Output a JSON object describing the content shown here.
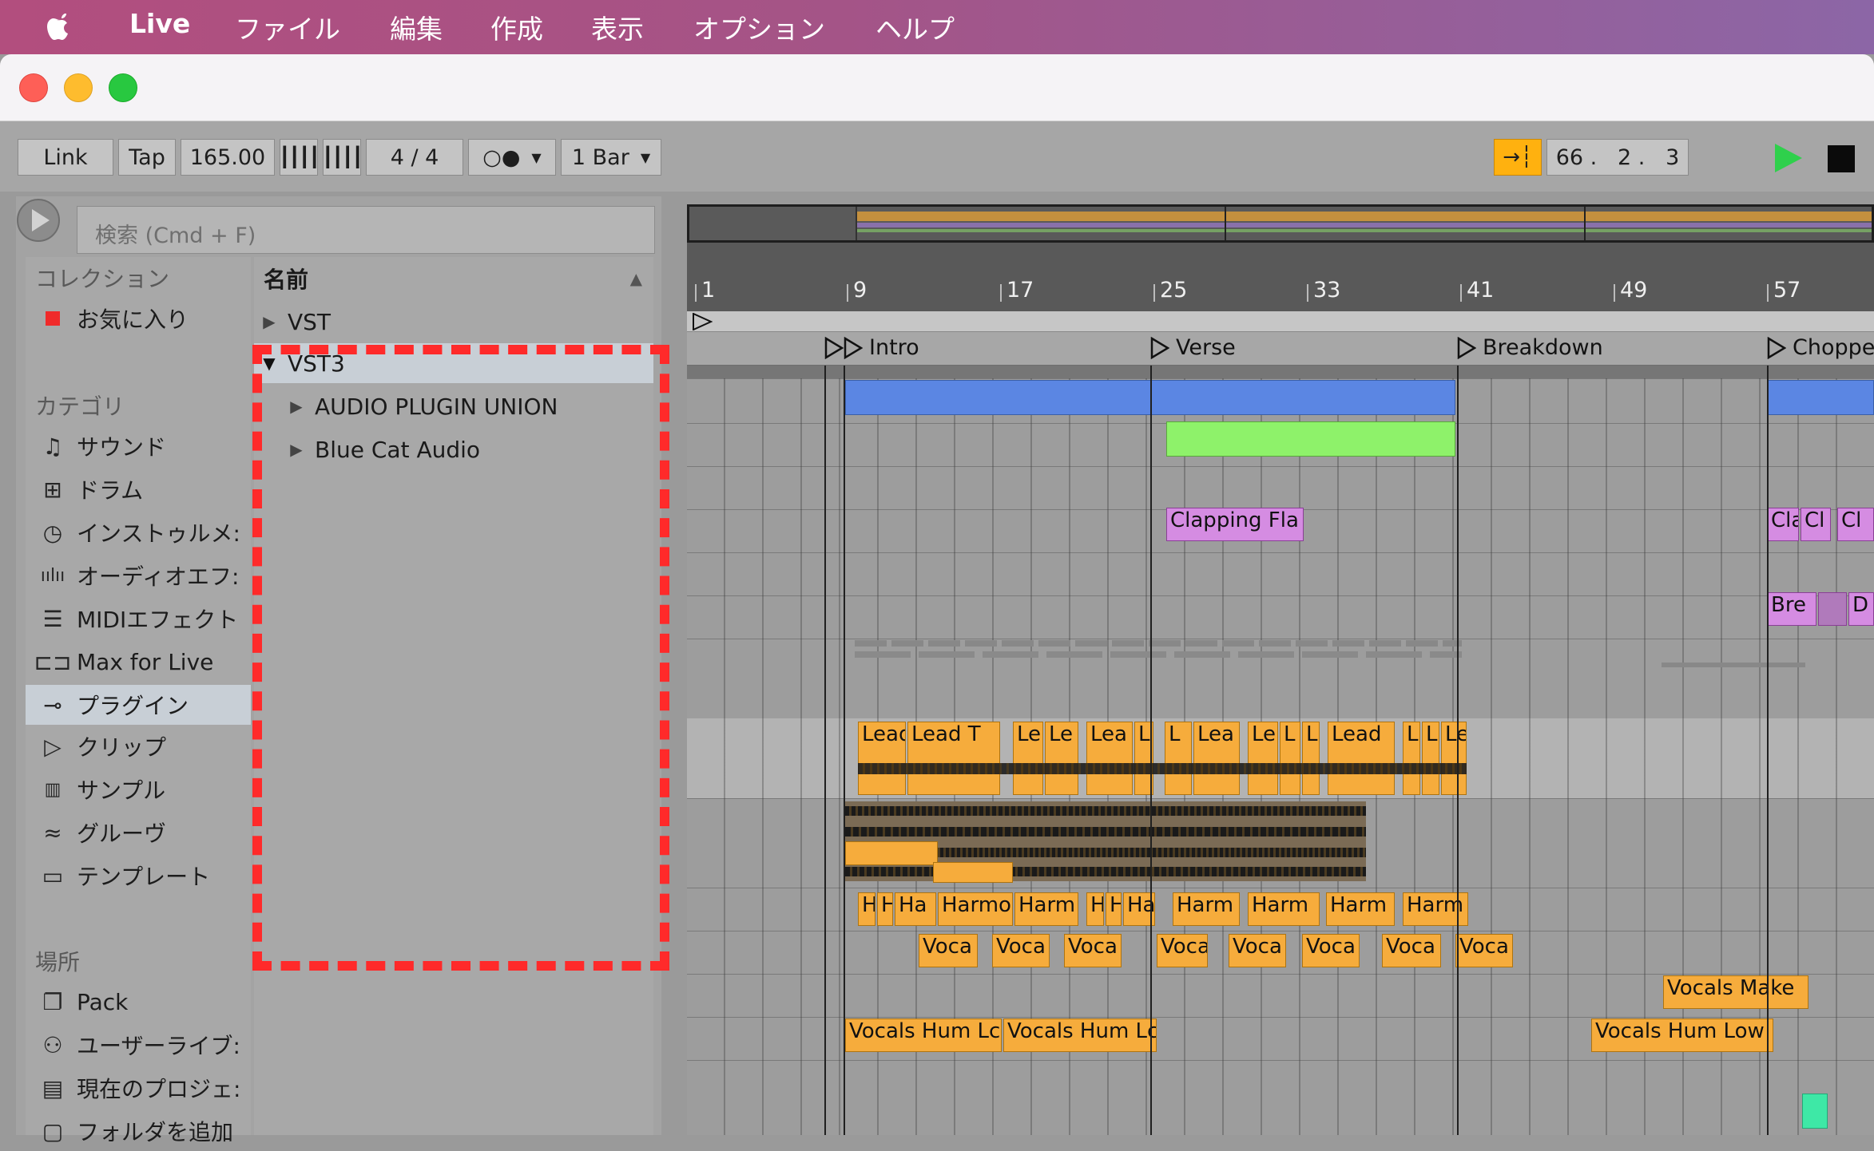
{
  "menubar": {
    "app_name": "Live",
    "items": [
      "ファイル",
      "編集",
      "作成",
      "表示",
      "オプション",
      "ヘルプ"
    ]
  },
  "transport": {
    "link": "Link",
    "tap": "Tap",
    "tempo": "165.00",
    "signature": "4 / 4",
    "metronome": "○●",
    "quantize": "1 Bar",
    "position": "66 .   2 .   3"
  },
  "browser": {
    "search_placeholder": "検索 (Cmd + F)",
    "collections_header": "コレクション",
    "favorites": "お気に入り",
    "categories_header": "カテゴリ",
    "categories": [
      {
        "label": "サウンド",
        "icon": "note-icon"
      },
      {
        "label": "ドラム",
        "icon": "grid-icon"
      },
      {
        "label": "インストゥルメ:",
        "icon": "clock-icon"
      },
      {
        "label": "オーディオエフ:",
        "icon": "waveform-icon"
      },
      {
        "label": "MIDIエフェクト",
        "icon": "midi-icon"
      },
      {
        "label": "Max for Live",
        "icon": "max-icon"
      },
      {
        "label": "プラグイン",
        "icon": "plug-icon"
      },
      {
        "label": "クリップ",
        "icon": "clip-icon"
      },
      {
        "label": "サンプル",
        "icon": "sample-icon"
      },
      {
        "label": "グルーヴ",
        "icon": "groove-icon"
      },
      {
        "label": "テンプレート",
        "icon": "template-icon"
      }
    ],
    "places_header": "場所",
    "places": [
      {
        "label": "Pack",
        "icon": "pack-icon"
      },
      {
        "label": "ユーザーライブ:",
        "icon": "user-icon"
      },
      {
        "label": "現在のプロジェ:",
        "icon": "project-icon"
      },
      {
        "label": "フォルダを追加",
        "icon": "folder-icon"
      }
    ],
    "list_header": "名前",
    "list_items": [
      {
        "label": "VST",
        "expanded": false,
        "indent": 0
      },
      {
        "label": "VST3",
        "expanded": true,
        "indent": 0
      },
      {
        "label": "AUDIO PLUGIN UNION",
        "expanded": false,
        "indent": 1
      },
      {
        "label": "Blue Cat Audio",
        "expanded": false,
        "indent": 1
      }
    ]
  },
  "arrangement": {
    "bar_numbers": [
      "1",
      "9",
      "17",
      "25",
      "33",
      "41",
      "49",
      "57"
    ],
    "locators": [
      "Intro",
      "Verse",
      "Breakdown",
      "Choppe"
    ],
    "clips": {
      "clap": [
        "Clapping Fla",
        "Cla",
        "Cl",
        "Cl"
      ],
      "break": [
        "Bre",
        "D"
      ],
      "lead": [
        "Lead T",
        "Lead T",
        "Le",
        "Le",
        "Lea",
        "L",
        "L",
        "Lea",
        "Le",
        "L",
        "L",
        "Lead",
        "L",
        "L",
        "Le"
      ],
      "harm": [
        "H",
        "H",
        "Ha",
        "Harmo",
        "Harm",
        "H",
        "H",
        "Ha",
        "Harm",
        "Harm",
        "Harm",
        "Harm"
      ],
      "voca": [
        "Voca",
        "Voca",
        "Voca",
        "Voca",
        "Voca",
        "Voca",
        "Voca",
        "Voca"
      ],
      "vocals_make": "Vocals Make",
      "vocals_hum": [
        "Vocals Hum Lc",
        "Vocals Hum Lc",
        "Vocals Hum Low"
      ]
    }
  },
  "colors": {
    "scene_bar": "#5b86e3",
    "green_clip": "#8ef26a",
    "orange_clip": "#f6ac3c",
    "purple_clip": "#d58ce2",
    "highlight": "#ff2a2a"
  }
}
